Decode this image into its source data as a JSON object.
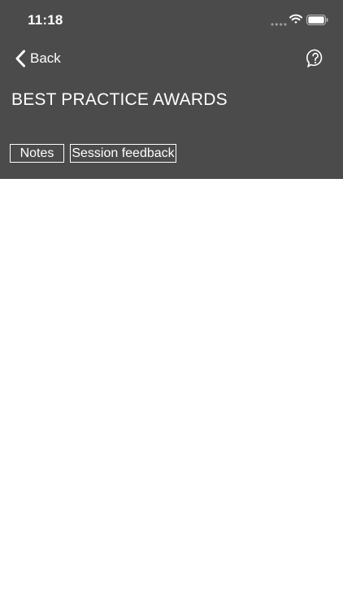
{
  "status_bar": {
    "time": "11:18",
    "icons": [
      "signal-dots-icon",
      "wifi-icon",
      "battery-icon"
    ]
  },
  "nav": {
    "back_label": "Back",
    "help_icon": "help-circle-icon"
  },
  "page": {
    "title": "BEST PRACTICE AWARDS"
  },
  "tabs": [
    {
      "label": "Notes"
    },
    {
      "label": "Session feedback"
    }
  ],
  "colors": {
    "header_background": "#4b4b4b",
    "header_text": "#ffffff",
    "content_background": "#ffffff"
  }
}
